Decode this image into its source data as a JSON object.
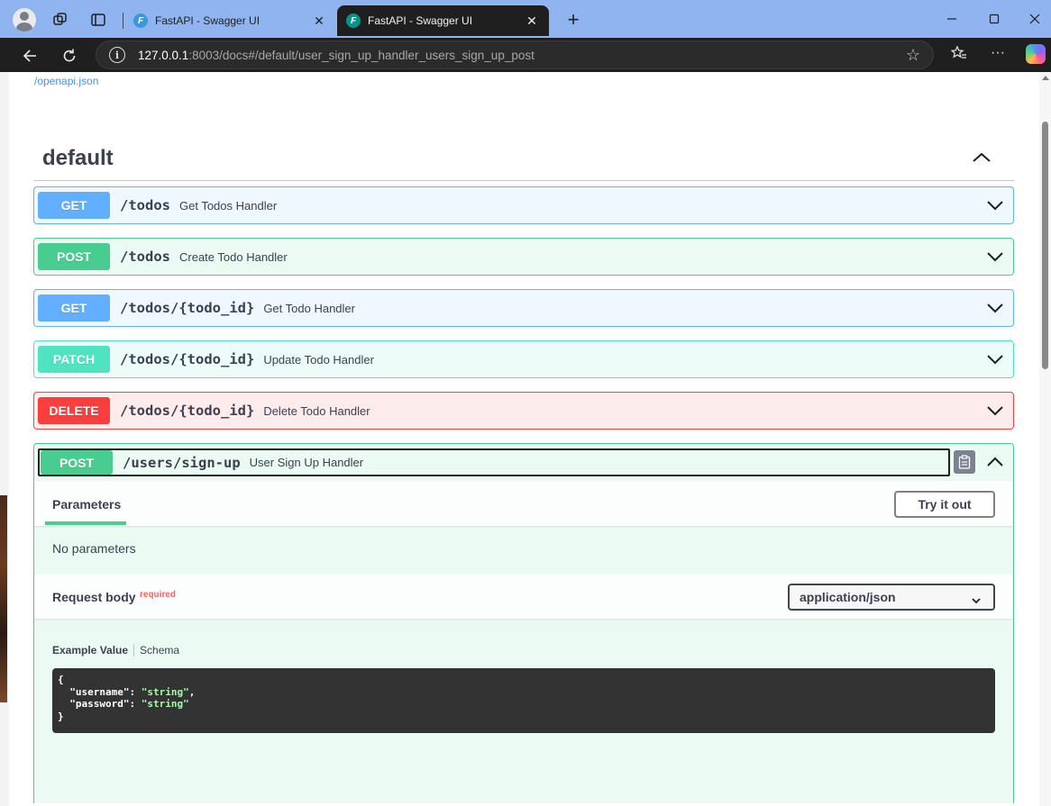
{
  "browser": {
    "tabs": [
      {
        "title": "FastAPI - Swagger UI",
        "active": false
      },
      {
        "title": "FastAPI - Swagger UI",
        "active": true
      }
    ],
    "url_host": "127.0.0.1",
    "url_rest": ":8003/docs#/default/user_sign_up_handler_users_sign_up_post"
  },
  "page": {
    "openapi_link": "/openapi.json",
    "section_title": "default",
    "operations": [
      {
        "method": "GET",
        "path": "/todos",
        "summary": "Get Todos Handler",
        "type": "get"
      },
      {
        "method": "POST",
        "path": "/todos",
        "summary": "Create Todo Handler",
        "type": "post"
      },
      {
        "method": "GET",
        "path": "/todos/{todo_id}",
        "summary": "Get Todo Handler",
        "type": "get"
      },
      {
        "method": "PATCH",
        "path": "/todos/{todo_id}",
        "summary": "Update Todo Handler",
        "type": "patch"
      },
      {
        "method": "DELETE",
        "path": "/todos/{todo_id}",
        "summary": "Delete Todo Handler",
        "type": "delete"
      },
      {
        "method": "POST",
        "path": "/users/sign-up",
        "summary": "User Sign Up Handler",
        "type": "post",
        "expanded": true
      }
    ],
    "expanded": {
      "parameters_tab": "Parameters",
      "try_it_out": "Try it out",
      "no_parameters": "No parameters",
      "request_body": "Request body",
      "required": "required",
      "content_type": "application/json",
      "example_value_tab": "Example Value",
      "schema_tab": "Schema",
      "code": {
        "open": "{",
        "k1": "\"username\"",
        "v1": "\"string\"",
        "k2": "\"password\"",
        "v2": "\"string\"",
        "close": "}"
      }
    }
  },
  "colors": {
    "get": "#61affe",
    "post": "#49cc90",
    "patch": "#50e3c2",
    "delete": "#f93e3e",
    "titlebar": "#8fb4f0"
  }
}
